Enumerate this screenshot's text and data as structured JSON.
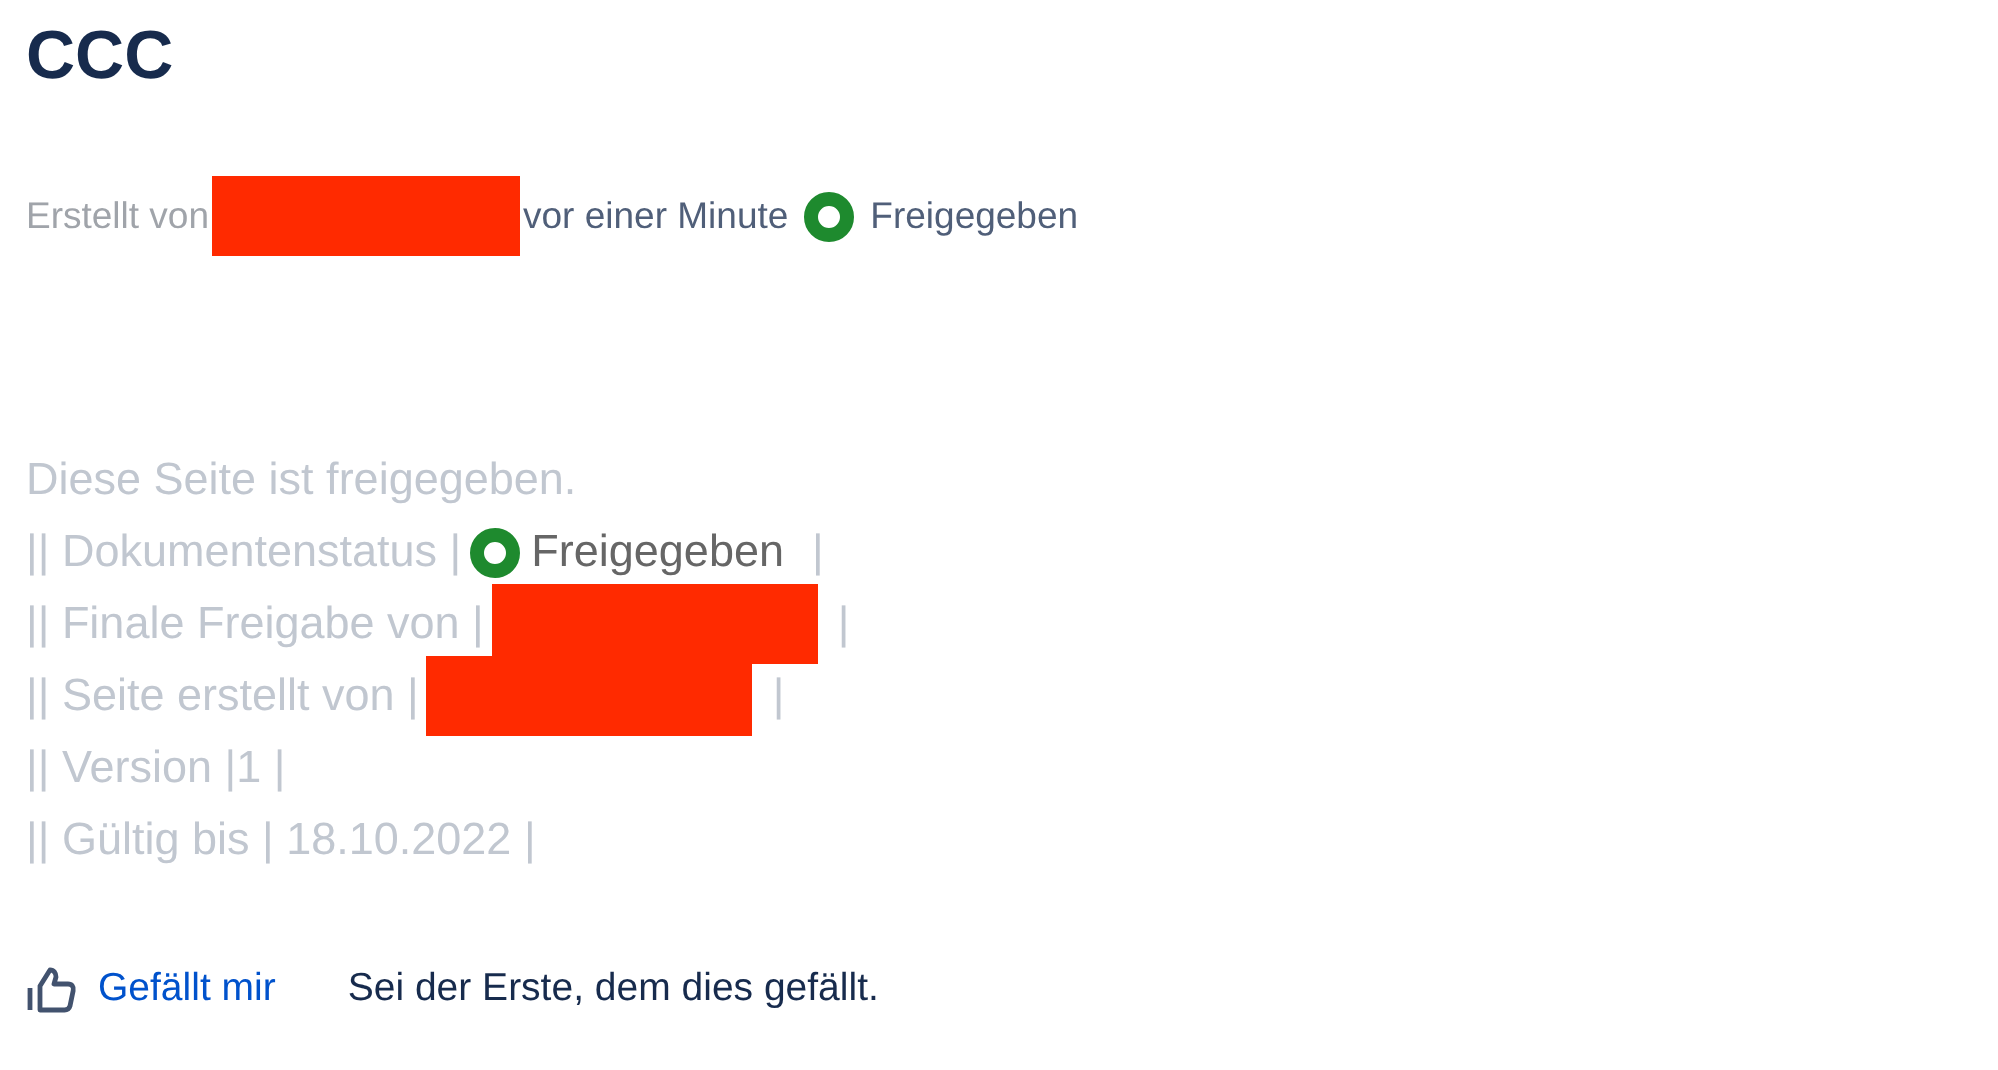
{
  "title": "CCC",
  "byline": [
    {
      "kind": "muted_text",
      "text": "Erstellt von"
    },
    {
      "kind": "redacted"
    },
    {
      "kind": "text",
      "text": "vor einer Minute"
    },
    {
      "kind": "status",
      "text": "Freigegeben",
      "color": "#1e8a2e"
    }
  ],
  "body_lines": [
    [
      {
        "kind": "text",
        "text": "Diese Seite ist freigegeben."
      }
    ],
    [
      {
        "kind": "text",
        "text": "|| Dokumentenstatus |"
      },
      {
        "kind": "status",
        "text": "Freigegeben",
        "color": "#1e8a2e"
      },
      {
        "kind": "text",
        "text": "|"
      }
    ],
    [
      {
        "kind": "text",
        "text": "|| Finale Freigabe von |"
      },
      {
        "kind": "redacted"
      },
      {
        "kind": "text",
        "text": "|"
      }
    ],
    [
      {
        "kind": "text",
        "text": "|| Seite erstellt von |"
      },
      {
        "kind": "redacted"
      },
      {
        "kind": "text",
        "text": "|"
      }
    ],
    [
      {
        "kind": "text",
        "text": "|| Version |1 |"
      }
    ],
    [
      {
        "kind": "text",
        "text": "|| Gültig bis | 18.10.2022 |"
      }
    ]
  ],
  "like": {
    "button": "Gefällt mir",
    "summary": "Sei der Erste, dem dies gefällt."
  }
}
